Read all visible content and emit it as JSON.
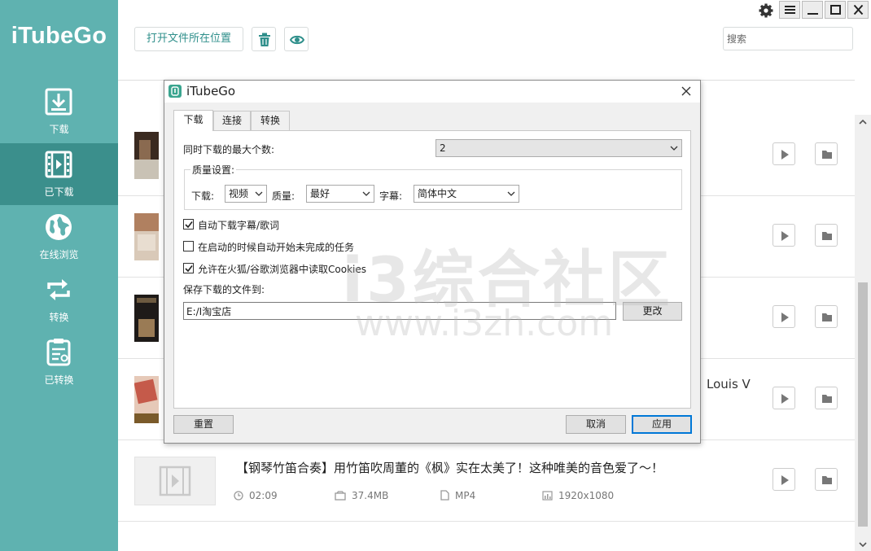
{
  "app": {
    "name": "iTubeGo"
  },
  "sidebar": {
    "items": [
      {
        "label": "下载",
        "icon": "download-icon"
      },
      {
        "label": "已下载",
        "icon": "film-icon"
      },
      {
        "label": "在线浏览",
        "icon": "globe-icon"
      },
      {
        "label": "转换",
        "icon": "convert-icon"
      },
      {
        "label": "已转换",
        "icon": "converted-list-icon"
      }
    ],
    "active_index": 1
  },
  "toolbar": {
    "open_folder_label": "打开文件所在位置",
    "delete_icon": "trash-icon",
    "preview_icon": "eye-icon",
    "search_placeholder": "搜索"
  },
  "window_controls": [
    "gear-icon",
    "menu-icon",
    "minimize-icon",
    "maximize-icon",
    "close-icon"
  ],
  "list": {
    "rows": [
      {
        "title": "",
        "duration": "",
        "size": "",
        "format": "",
        "resolution": ""
      },
      {
        "title": "",
        "duration": "",
        "size": "",
        "format": "",
        "resolution": ""
      },
      {
        "title": "",
        "duration": "",
        "size": "",
        "format": "",
        "resolution": ""
      },
      {
        "title": "Louis V",
        "duration": "",
        "size": "",
        "format": "",
        "resolution": ""
      },
      {
        "title": "【钢琴竹笛合奏】用竹笛吹周董的《枫》实在太美了！这种唯美的音色爱了～！",
        "duration": "02:09",
        "size": "37.4MB",
        "format": "MP4",
        "resolution": "1920x1080"
      }
    ]
  },
  "watermark": {
    "big": "i3综合社区",
    "small": "www.i3zh.com"
  },
  "dialog": {
    "title": "iTubeGo",
    "tabs": [
      "下载",
      "连接",
      "转换"
    ],
    "active_tab": 0,
    "max_downloads_label": "同时下载的最大个数:",
    "max_downloads_value": "2",
    "quality_group_title": "质量设置:",
    "download_label": "下载:",
    "download_value": "视频",
    "quality_label": "质量:",
    "quality_value": "最好",
    "subtitle_label": "字幕:",
    "subtitle_value": "简体中文",
    "checkboxes": [
      {
        "label": "自动下载字幕/歌词",
        "checked": true
      },
      {
        "label": "在启动的时候自动开始未完成的任务",
        "checked": false
      },
      {
        "label": "允许在火狐/谷歌浏览器中读取Cookies",
        "checked": true
      }
    ],
    "save_to_label": "保存下载的文件到:",
    "save_path": "E:/I淘宝店",
    "change_button": "更改",
    "reset_button": "重置",
    "cancel_button": "取消",
    "apply_button": "应用"
  }
}
